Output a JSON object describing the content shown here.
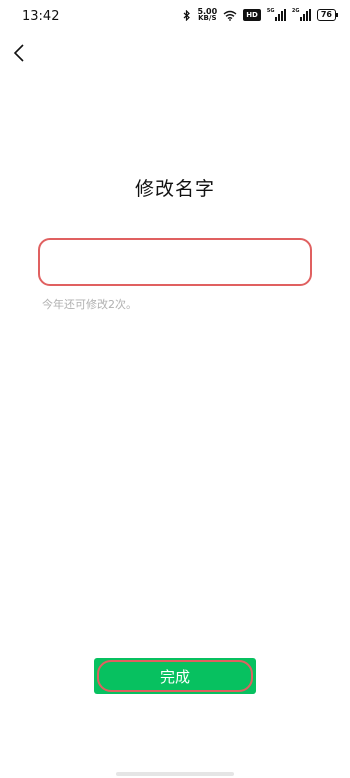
{
  "status_bar": {
    "time": "13:42",
    "net_speed": "5.00",
    "net_unit": "KB/S",
    "hd_badge": "HD",
    "sim1_label": "5G",
    "sim2_label": "2G",
    "battery": "76"
  },
  "header": {
    "back_icon": "chevron-left-icon"
  },
  "main": {
    "title": "修改名字",
    "name_input_value": "",
    "name_input_placeholder": "",
    "hint": "今年还可修改2次。"
  },
  "footer": {
    "done_label": "完成",
    "accent_color": "#07c160",
    "highlight_color": "#e06060"
  }
}
